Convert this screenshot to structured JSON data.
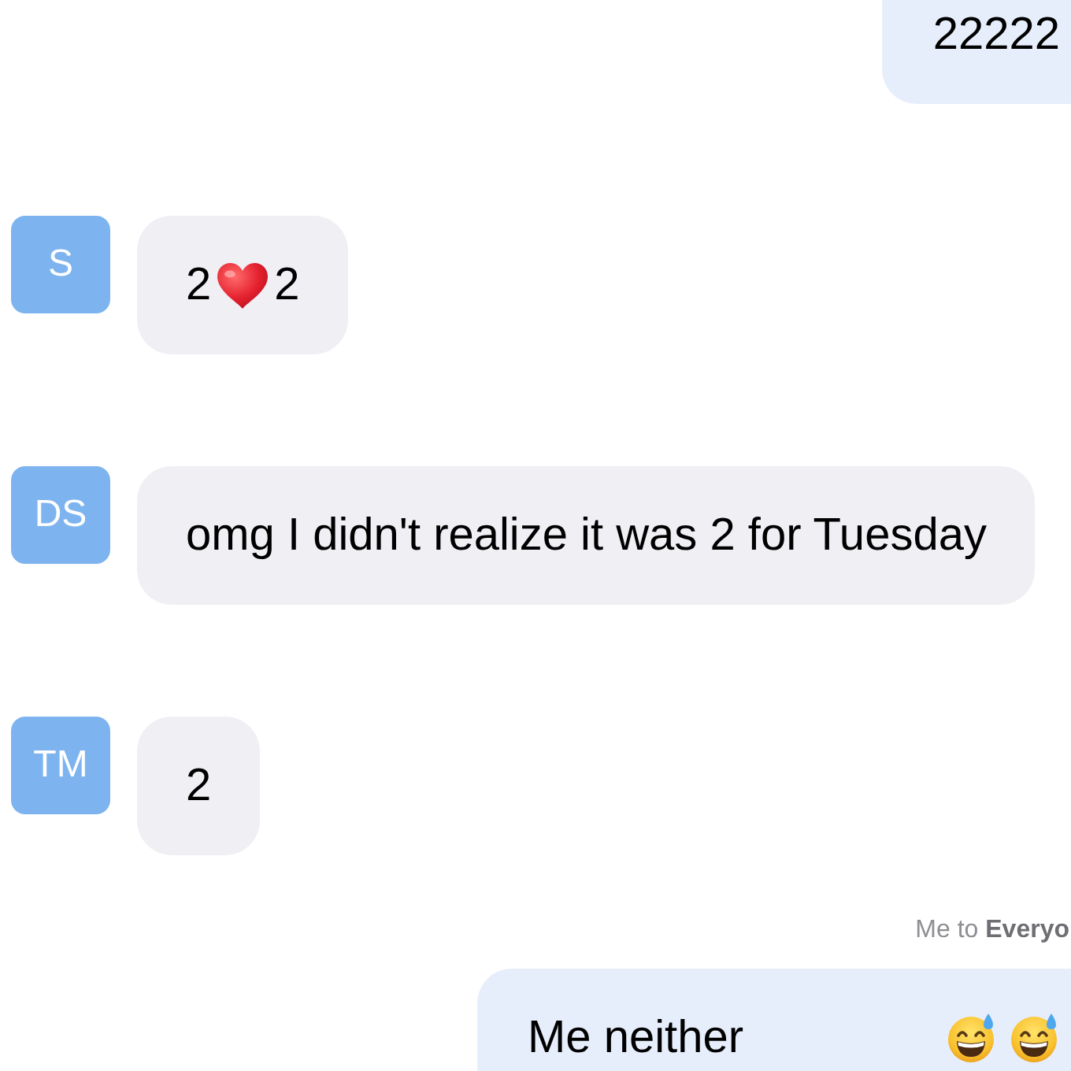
{
  "messages": [
    {
      "kind": "outgoing",
      "parts": [
        {
          "kind": "text",
          "text": "22222"
        }
      ]
    },
    {
      "kind": "incoming",
      "avatar": "S",
      "parts": [
        {
          "kind": "text",
          "text": "2"
        },
        {
          "kind": "heart"
        },
        {
          "kind": "text",
          "text": "2"
        }
      ]
    },
    {
      "kind": "incoming",
      "avatar": "DS",
      "parts": [
        {
          "kind": "text",
          "text": "omg I didn't realize it was 2 for Tuesday"
        }
      ]
    },
    {
      "kind": "incoming",
      "avatar": "TM",
      "parts": [
        {
          "kind": "text",
          "text": "2"
        }
      ]
    },
    {
      "kind": "outgoing",
      "sender_line": "Me to **Everyo**",
      "parts": [
        {
          "kind": "text",
          "text": "Me neither"
        }
      ],
      "emojis": [
        {
          "kind": "grin-sweat"
        },
        {
          "kind": "grin-sweat"
        }
      ]
    }
  ]
}
